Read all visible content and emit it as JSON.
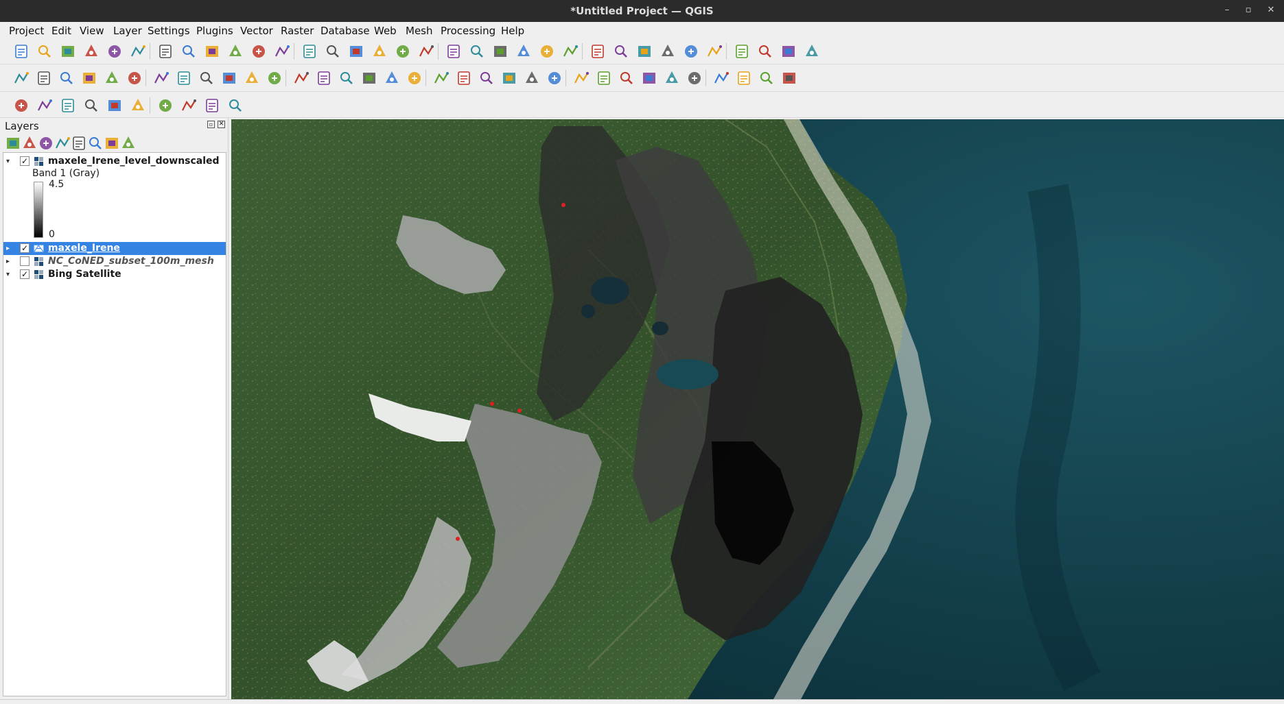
{
  "window": {
    "title": "*Untitled Project — QGIS",
    "controls": [
      "–",
      "▫",
      "✕"
    ]
  },
  "menu": {
    "items": [
      "Project",
      "Edit",
      "View",
      "Layer",
      "Settings",
      "Plugins",
      "Vector",
      "Raster",
      "Database",
      "Web",
      "Mesh",
      "Processing",
      "Help"
    ]
  },
  "toolbar": {
    "rows": [
      [
        "new-project-icon",
        "open-project-icon",
        "save-project-icon",
        "save-as-icon",
        "print-layout-icon",
        "style-manager-icon",
        "pan-icon",
        "pan-to-selection-icon",
        "zoom-in-icon",
        "zoom-out-icon",
        "zoom-full-icon",
        "zoom-to-selection-icon",
        "zoom-to-layer-icon",
        "zoom-native-icon",
        "zoom-last-icon",
        "zoom-next-icon",
        "new-map-view-icon",
        "new-3d-view-icon",
        "bookmark-icon",
        "show-bookmarks-icon",
        "temporal-controller-icon",
        "refresh-icon",
        "select-features-icon",
        "select-by-value-icon",
        "deselect-icon",
        "select-location-icon",
        "identify-icon",
        "attribute-table-icon",
        "processing-toolbox-icon",
        "statistics-icon",
        "open-field-calculator-icon",
        "measure-icon",
        "map-tips-icon",
        "locator-icon"
      ],
      [
        "open-data-source-icon",
        "new-geopackage-icon",
        "new-shapefile-icon",
        "new-spatialite-icon",
        "new-virtual-layer-icon",
        "new-temp-layer-icon",
        "new-mesh-layer-icon",
        "toggle-editing-icon",
        "pencil-icon",
        "save-edits-icon",
        "digitize-icon",
        "add-polygon-icon",
        "vertex-tool-icon",
        "modify-attributes-icon",
        "delete-selected-icon",
        "cut-features-icon",
        "copy-features-icon",
        "paste-features-icon",
        "undo-icon",
        "redo-icon",
        "label-tool-icon",
        "layer-diagram-icon",
        "pin-labels-icon",
        "show-labels-icon",
        "move-label-icon",
        "rotate-label-icon",
        "change-label-icon",
        "label-props-icon",
        "label-rules-icon",
        "wms-layer-icon",
        "wcs-layer-icon",
        "wfs-layer-icon",
        "python-console-icon",
        "help-icon"
      ],
      [
        "georeferencer-icon",
        "raster-calc-icon",
        "annotation-icon",
        "coordinate-capture-icon",
        "geometry-checker-icon",
        "topology-checker-icon",
        "db-manager-icon",
        "gps-icon",
        "info-icon",
        "plugin-manager-icon"
      ]
    ]
  },
  "layers": {
    "title": "Layers",
    "toolbar_icons": [
      "open-layer-styling-icon",
      "add-group-icon",
      "manage-visibility-icon",
      "filter-legend-icon",
      "filter-expression-icon",
      "expand-all-icon",
      "collapse-all-icon",
      "remove-layer-icon"
    ],
    "items": [
      {
        "name": "maxele_Irene_level_downscaled",
        "checked": "✓",
        "expander": "▾",
        "style": "bold",
        "icon": "raster-icon"
      },
      {
        "name": "maxele_Irene",
        "checked": "✓",
        "expander": "▸",
        "style": "selected",
        "icon": "mesh-icon"
      },
      {
        "name": "NC_CoNED_subset_100m_mesh",
        "checked": "",
        "expander": "▸",
        "style": "italic",
        "icon": "raster-icon"
      },
      {
        "name": "Bing Satellite",
        "checked": "✓",
        "expander": "▾",
        "style": "bold",
        "icon": "raster-icon"
      }
    ],
    "legend": {
      "band": "Band 1 (Gray)",
      "max": "4.5",
      "min": "0"
    }
  },
  "colors": {
    "selection": "#3584e4",
    "titlebar": "#2b2b2b",
    "panel": "#efefef",
    "ocean": "#0f3b45",
    "land": "#3a5a30"
  }
}
